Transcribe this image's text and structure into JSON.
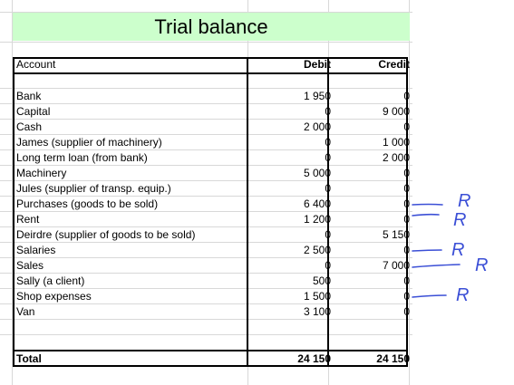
{
  "sheet": {
    "title": "Trial balance",
    "headers": {
      "account": "Account",
      "debit": "Debit",
      "credit": "Credit"
    },
    "rows": [
      {
        "account": "Bank",
        "debit": "1 950",
        "credit": "0"
      },
      {
        "account": "Capital",
        "debit": "0",
        "credit": "9 000"
      },
      {
        "account": "Cash",
        "debit": "2 000",
        "credit": "0"
      },
      {
        "account": "James (supplier of machinery)",
        "debit": "0",
        "credit": "1 000"
      },
      {
        "account": "Long term loan (from bank)",
        "debit": "0",
        "credit": "2 000"
      },
      {
        "account": "Machinery",
        "debit": "5 000",
        "credit": "0"
      },
      {
        "account": "Jules (supplier of transp. equip.)",
        "debit": "0",
        "credit": "0"
      },
      {
        "account": "Purchases (goods to be sold)",
        "debit": "6 400",
        "credit": "0"
      },
      {
        "account": "Rent",
        "debit": "1 200",
        "credit": "0"
      },
      {
        "account": "Deirdre (supplier of goods to be sold)",
        "debit": "0",
        "credit": "5 150"
      },
      {
        "account": "Salaries",
        "debit": "2 500",
        "credit": "0"
      },
      {
        "account": "Sales",
        "debit": "0",
        "credit": "7 000"
      },
      {
        "account": "Sally (a client)",
        "debit": "500",
        "credit": "0"
      },
      {
        "account": "Shop expenses",
        "debit": "1 500",
        "credit": "0"
      },
      {
        "account": "Van",
        "debit": "3 100",
        "credit": "0"
      }
    ],
    "total": {
      "label": "Total",
      "debit": "24 150",
      "credit": "24 150"
    }
  },
  "annotations": {
    "mark_letter": "R",
    "ink_color": "#3b4fd6"
  }
}
